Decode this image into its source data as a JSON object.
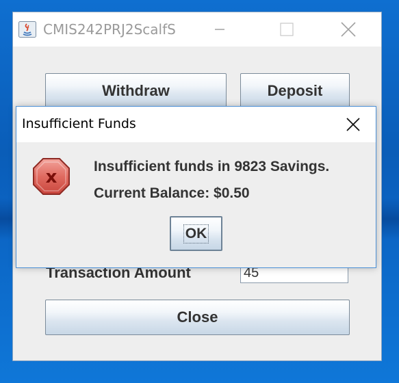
{
  "main_window": {
    "title": "CMIS242PRJ2ScalfS",
    "buttons": {
      "withdraw": "Withdraw",
      "deposit": "Deposit",
      "close": "Close"
    },
    "transaction_amount_label": "Transaction Amount",
    "transaction_amount_value": "45"
  },
  "dialog": {
    "title": "Insufficient Funds",
    "message_line1": "Insufficient funds in 9823 Savings.",
    "message_line2": "Current Balance: $0.50",
    "ok_label": "OK",
    "icon": "error-icon"
  },
  "colors": {
    "desktop": "#0b63c2",
    "window_bg": "#eeeeee",
    "dialog_border": "#4a8fd6",
    "error_red": "#d6423a"
  }
}
